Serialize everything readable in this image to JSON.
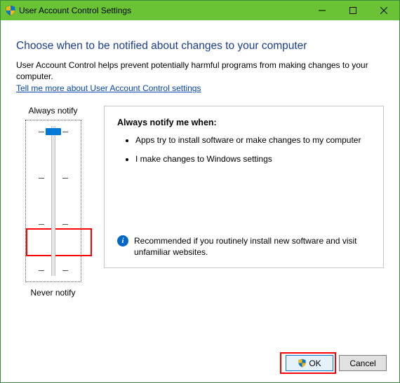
{
  "titlebar": {
    "title": "User Account Control Settings"
  },
  "heading": "Choose when to be notified about changes to your computer",
  "description": "User Account Control helps prevent potentially harmful programs from making changes to your computer.",
  "help_link": "Tell me more about User Account Control settings",
  "slider": {
    "top_label": "Always notify",
    "bottom_label": "Never notify"
  },
  "detail": {
    "title": "Always notify me when:",
    "bullets": [
      "Apps try to install software or make changes to my computer",
      "I make changes to Windows settings"
    ],
    "recommendation": "Recommended if you routinely install new software and visit unfamiliar websites."
  },
  "buttons": {
    "ok": "OK",
    "cancel": "Cancel"
  }
}
